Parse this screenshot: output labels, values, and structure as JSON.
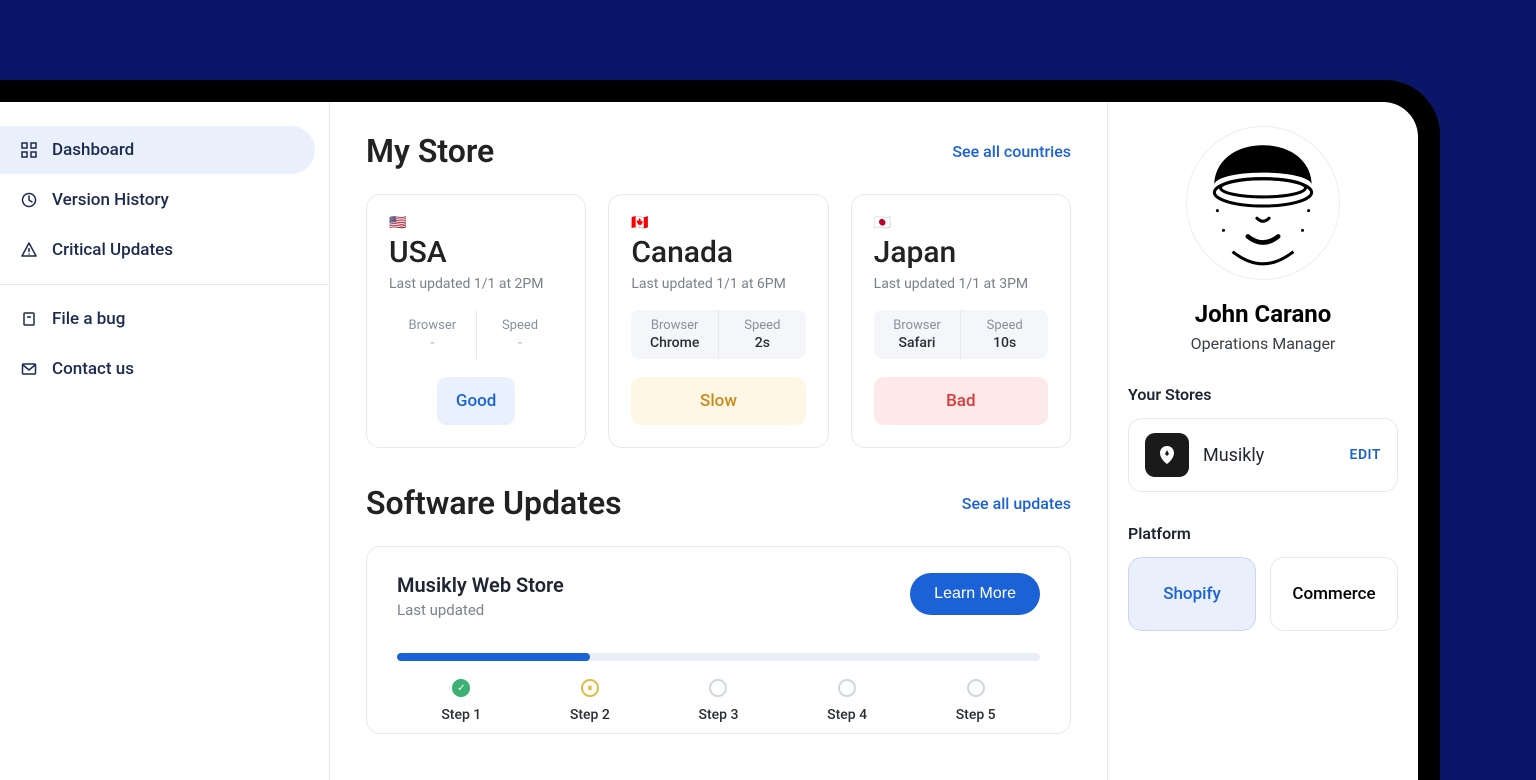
{
  "sidebar": {
    "items": [
      {
        "label": "Dashboard",
        "active": true
      },
      {
        "label": "Version History",
        "active": false
      },
      {
        "label": "Critical Updates",
        "active": false
      }
    ],
    "secondary": [
      {
        "label": "File a bug"
      },
      {
        "label": "Contact us"
      }
    ]
  },
  "mystore": {
    "title": "My Store",
    "see_all": "See all countries",
    "cards": [
      {
        "flag": "🇺🇸",
        "country": "USA",
        "updated": "Last updated 1/1 at 2PM",
        "browser_label": "Browser",
        "browser": "-",
        "speed_label": "Speed",
        "speed": "-",
        "status_text": "Good",
        "status_class": "good",
        "shaded": false
      },
      {
        "flag": "🇨🇦",
        "country": "Canada",
        "updated": "Last updated 1/1 at 6PM",
        "browser_label": "Browser",
        "browser": "Chrome",
        "speed_label": "Speed",
        "speed": "2s",
        "status_text": "Slow",
        "status_class": "slow",
        "shaded": true
      },
      {
        "flag": "🇯🇵",
        "country": "Japan",
        "updated": "Last updated 1/1 at 3PM",
        "browser_label": "Browser",
        "browser": "Safari",
        "speed_label": "Speed",
        "speed": "10s",
        "status_text": "Bad",
        "status_class": "bad",
        "shaded": true
      }
    ]
  },
  "software_updates": {
    "title": "Software Updates",
    "see_all": "See all updates",
    "panel": {
      "title": "Musikly Web Store",
      "subtitle": "Last updated",
      "learn_more": "Learn More",
      "progress_percent": 30,
      "steps": [
        {
          "label": "Step 1",
          "state": "done"
        },
        {
          "label": "Step 2",
          "state": "current"
        },
        {
          "label": "Step 3",
          "state": "pending"
        },
        {
          "label": "Step 4",
          "state": "pending"
        },
        {
          "label": "Step 5",
          "state": "pending"
        }
      ]
    }
  },
  "profile": {
    "name": "John Carano",
    "role": "Operations Manager",
    "stores_title": "Your Stores",
    "store": {
      "name": "Musikly",
      "edit": "EDIT"
    },
    "platform_title": "Platform",
    "platforms": [
      {
        "label": "Shopify",
        "selected": true
      },
      {
        "label": "Commerce",
        "selected": false
      }
    ]
  }
}
